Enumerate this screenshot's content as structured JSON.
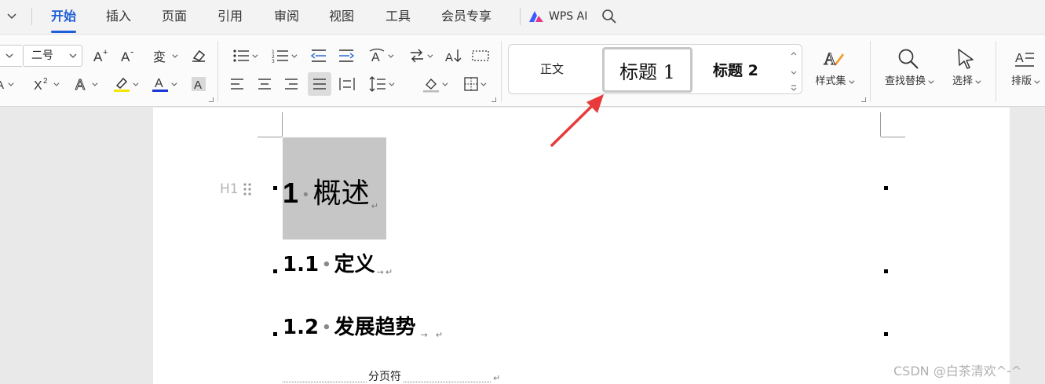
{
  "menu": {
    "tabs": [
      "开始",
      "插入",
      "页面",
      "引用",
      "审阅",
      "视图",
      "工具",
      "会员专享"
    ],
    "active_tab": "开始",
    "ai_label": "WPS AI"
  },
  "ribbon": {
    "font_size": "二号",
    "styles": {
      "normal": "正文",
      "heading1": "标题 1",
      "heading2": "标题 2"
    },
    "style_set_label": "样式集",
    "find_replace_label": "查找替换",
    "select_label": "选择",
    "layout_label": "排版"
  },
  "document": {
    "heading_marker": "H1",
    "h1": {
      "number": "1",
      "title": "概述"
    },
    "h2a": {
      "number": "1.1",
      "title": "定义"
    },
    "h2b": {
      "number": "1.2",
      "title": "发展趋势"
    },
    "page_break_label": "分页符",
    "para_mark": "↵",
    "tab_mark": "→"
  },
  "watermark": "CSDN @白茶清欢^-^",
  "colors": {
    "accent": "#1f5fd6",
    "arrow": "#e8393b",
    "highlight": "#f5e600",
    "font_color": "#1c35d6"
  }
}
